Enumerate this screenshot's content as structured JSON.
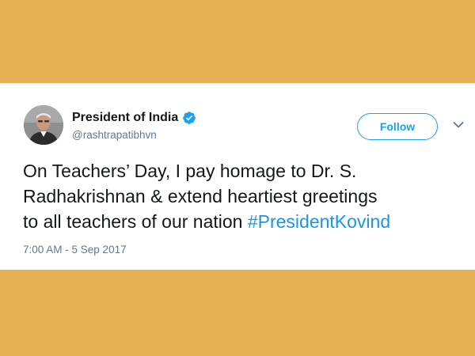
{
  "colors": {
    "background": "#e6b054",
    "card": "#ffffff",
    "text": "#14171a",
    "secondary_text": "#657786",
    "accent": "#1da1f2",
    "hashtag": "#1b95e0"
  },
  "tweet": {
    "author": {
      "display_name": "President of India",
      "handle": "@rashtrapatibhvn",
      "verified": true,
      "avatar_icon": "profile-photo"
    },
    "follow_button_label": "Follow",
    "menu_icon": "chevron-down-icon",
    "text_parts": {
      "line1": "On Teachers’ Day, I pay homage to Dr. S.",
      "line2": "Radhakrishnan & extend heartiest greetings",
      "line3_text": "to all teachers of our nation ",
      "hashtag": "#PresidentKovind"
    },
    "timestamp": "7:00 AM - 5 Sep 2017"
  }
}
